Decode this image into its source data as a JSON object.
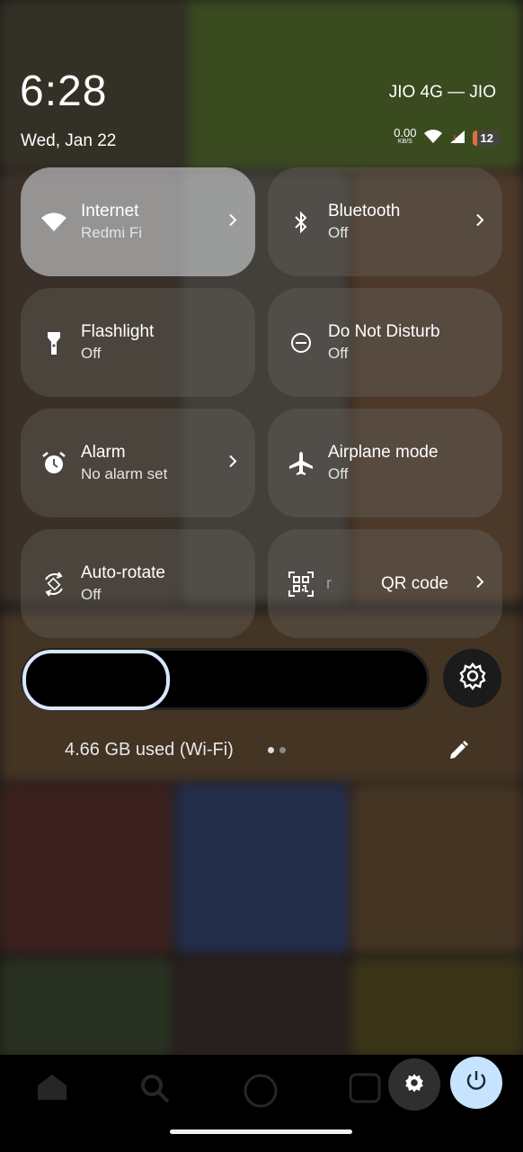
{
  "status_bar": {
    "time": "6:28",
    "date": "Wed, Jan 22",
    "carrier": "JIO 4G — JIO",
    "net_speed": "0.00",
    "net_speed_unit": "KB/S",
    "battery": "12",
    "icons": [
      "wifi-icon",
      "signal-icon"
    ]
  },
  "tiles": [
    {
      "title": "Internet",
      "subtitle": "Redmi Fi",
      "icon": "wifi-icon",
      "active": true,
      "chevron": true
    },
    {
      "title": "Bluetooth",
      "subtitle": "Off",
      "icon": "bluetooth-icon",
      "active": false,
      "chevron": true
    },
    {
      "title": "Flashlight",
      "subtitle": "Off",
      "icon": "flashlight-icon",
      "active": false,
      "chevron": false
    },
    {
      "title": "Do Not Disturb",
      "subtitle": "Off",
      "icon": "do-not-disturb-icon",
      "active": false,
      "chevron": false
    },
    {
      "title": "Alarm",
      "subtitle": "No alarm set",
      "icon": "alarm-icon",
      "active": false,
      "chevron": true
    },
    {
      "title": "Airplane mode",
      "subtitle": "Off",
      "icon": "airplane-icon",
      "active": false,
      "chevron": false
    },
    {
      "title": "Auto-rotate",
      "subtitle": "Off",
      "icon": "auto-rotate-icon",
      "active": false,
      "chevron": false
    }
  ],
  "qr_tile": {
    "ghost_text": "r",
    "label": "QR code",
    "icon": "qr-scanner-icon"
  },
  "brightness": {
    "level": 0.3
  },
  "data_usage": "4.66 GB used (Wi-Fi)",
  "pages": {
    "current": 1,
    "total": 2
  },
  "colors": {
    "accent": "#c6e4ff",
    "slider_outline": "#d7e8ff",
    "battery_low": "#e0703a"
  }
}
